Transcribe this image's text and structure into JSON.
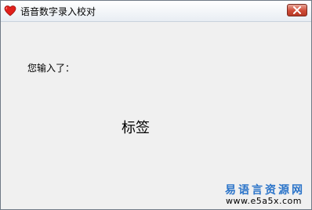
{
  "window": {
    "title": "语音数字录入校对",
    "icon": "heart-icon",
    "close_icon": "close-icon"
  },
  "content": {
    "input_label": "您输入了：",
    "big_label": "标签"
  },
  "watermark": {
    "title": "易语言资源网",
    "url": "www.e5a5x.com"
  },
  "colors": {
    "heart": "#e0201c",
    "close_button": "#cf4a36",
    "watermark_blue": "#2b74c9"
  }
}
